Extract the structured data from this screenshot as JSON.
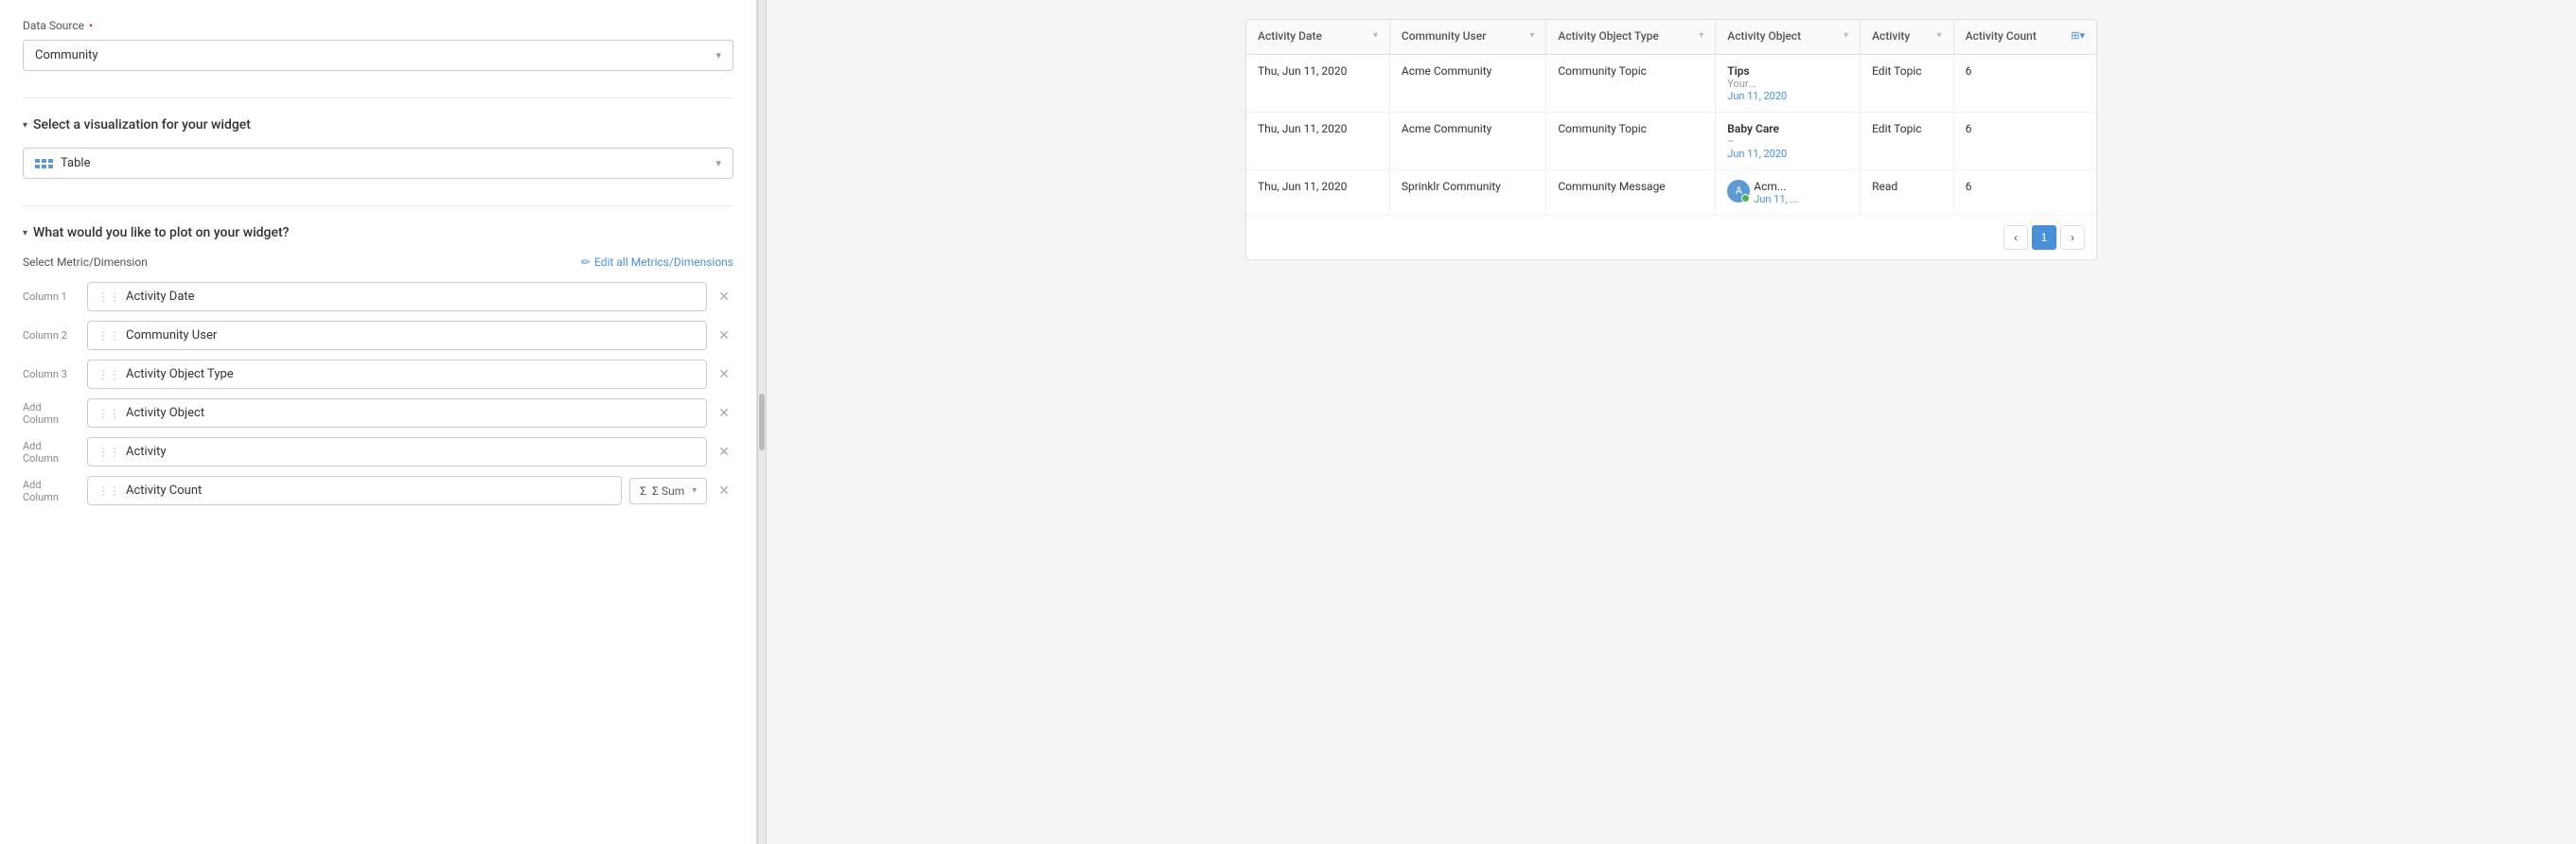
{
  "left": {
    "data_source_label": "Data Source",
    "data_source_required": "•",
    "data_source_value": "Community",
    "data_source_chevron": "▾",
    "viz_section_header": "Select a visualization for your widget",
    "viz_caret": "▾",
    "viz_value": "Table",
    "plot_section_header": "What would you like to plot on your widget?",
    "plot_caret": "▾",
    "metric_label": "Select Metric/Dimension",
    "edit_link_label": "Edit all Metrics/Dimensions",
    "columns": [
      {
        "id": "col1",
        "label": "Column 1",
        "value": "Activity Date"
      },
      {
        "id": "col2",
        "label": "Column 2",
        "value": "Community User"
      },
      {
        "id": "col3",
        "label": "Column 3",
        "value": "Activity Object Type"
      },
      {
        "id": "col4",
        "label": "Add Column",
        "value": "Activity Object"
      },
      {
        "id": "col5",
        "label": "Add Column",
        "value": "Activity"
      },
      {
        "id": "col6",
        "label": "Add Column",
        "value": "Activity Count",
        "suffix": "Σ Sum"
      }
    ]
  },
  "table": {
    "columns": [
      {
        "id": "activity_date",
        "label": "Activity Date"
      },
      {
        "id": "community_user",
        "label": "Community User"
      },
      {
        "id": "activity_object_type",
        "label": "Activity Object Type"
      },
      {
        "id": "activity_object",
        "label": "Activity Object"
      },
      {
        "id": "activity",
        "label": "Activity"
      },
      {
        "id": "activity_count",
        "label": "Activity Count"
      }
    ],
    "rows": [
      {
        "activity_date": "Thu, Jun 11, 2020",
        "community_user": "Acme Community",
        "activity_object_type": "Community Topic",
        "obj_title": "Tips",
        "obj_sub": "Your...",
        "obj_date": "Jun 11, 2020",
        "activity": "Edit Topic",
        "activity_count": "6"
      },
      {
        "activity_date": "Thu, Jun 11, 2020",
        "community_user": "Acme Community",
        "activity_object_type": "Community Topic",
        "obj_title": "Baby Care",
        "obj_sub": "–",
        "obj_date": "Jun 11, 2020",
        "activity": "Edit Topic",
        "activity_count": "6"
      },
      {
        "activity_date": "Thu, Jun 11, 2020",
        "community_user": "Sprinklr Community",
        "activity_object_type": "Community Message",
        "obj_title": "Acm...",
        "obj_sub": "...",
        "obj_date": "Jun 11, ...",
        "activity": "Read",
        "activity_count": "6",
        "has_avatar": true,
        "avatar_letter": "A"
      }
    ],
    "pagination": {
      "prev_label": "‹",
      "page_label": "1",
      "next_label": "›"
    }
  }
}
